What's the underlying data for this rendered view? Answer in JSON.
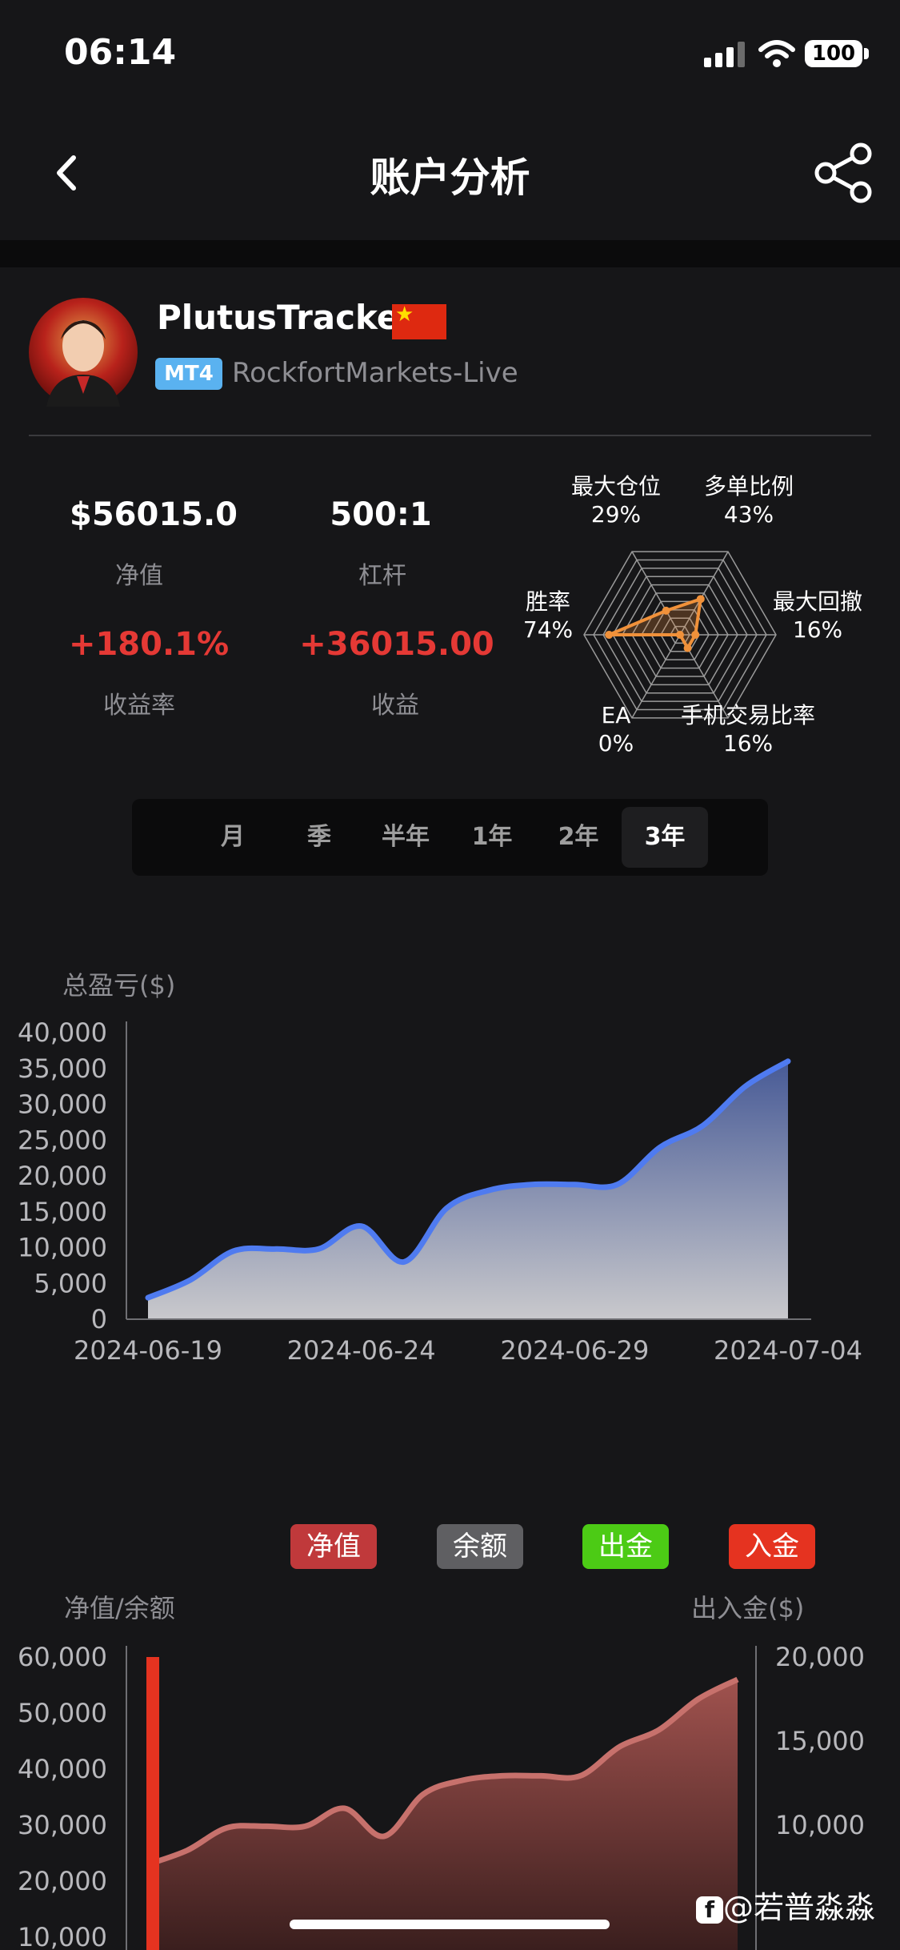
{
  "status_bar": {
    "time": "06:14",
    "battery": "100"
  },
  "header": {
    "title": "账户分析"
  },
  "profile": {
    "name": "PlutusTracker",
    "platform": "MT4",
    "server": "RockfortMarkets-Live"
  },
  "stats": {
    "equity_value": "$56015.0",
    "equity_label": "净值",
    "leverage_value": "500:1",
    "leverage_label": "杠杆",
    "return_rate_value": "+180.1%",
    "return_rate_label": "收益率",
    "profit_value": "+36015.00",
    "profit_label": "收益"
  },
  "radar": {
    "axes": [
      {
        "name": "多单比例",
        "value": "43%",
        "v": 0.43
      },
      {
        "name": "最大回撤",
        "value": "16%",
        "v": 0.16
      },
      {
        "name": "手机交易比率",
        "value": "16%",
        "v": 0.16
      },
      {
        "name": "EA",
        "value": "0%",
        "v": 0.0
      },
      {
        "name": "胜率",
        "value": "74%",
        "v": 0.74
      },
      {
        "name": "最大仓位",
        "value": "29%",
        "v": 0.29
      }
    ],
    "color": "#f0913a"
  },
  "period_tabs": {
    "items": [
      "月",
      "季",
      "半年",
      "1年",
      "2年",
      "3年"
    ],
    "active": "3年"
  },
  "pnl_chart": {
    "ylabel": "总盈亏($)"
  },
  "balance_chart": {
    "left_label": "净值/余额",
    "right_label": "出入金($)",
    "legend": [
      {
        "label": "净值",
        "color": "#c0393b"
      },
      {
        "label": "余额",
        "color": "#5f5f62"
      },
      {
        "label": "出金",
        "color": "#4ccb15"
      },
      {
        "label": "入金",
        "color": "#e53320"
      }
    ]
  },
  "watermark": "@若普淼淼",
  "chart_data": [
    {
      "type": "area",
      "title": "",
      "ylabel": "总盈亏($)",
      "xlabel": "",
      "ylim": [
        0,
        40000
      ],
      "yticks": [
        "0",
        "5,000",
        "10,000",
        "15,000",
        "20,000",
        "25,000",
        "30,000",
        "35,000",
        "40,000"
      ],
      "xticks": [
        "2024-06-19",
        "2024-06-24",
        "2024-06-29",
        "2024-07-04"
      ],
      "x": [
        "2024-06-19",
        "2024-06-20",
        "2024-06-21",
        "2024-06-22",
        "2024-06-23",
        "2024-06-24",
        "2024-06-25",
        "2024-06-26",
        "2024-06-27",
        "2024-06-28",
        "2024-06-29",
        "2024-06-30",
        "2024-07-01",
        "2024-07-02",
        "2024-07-03",
        "2024-07-04"
      ],
      "series": [
        {
          "values": [
            3000,
            5500,
            9500,
            9800,
            9800,
            13000,
            8000,
            15500,
            18000,
            18800,
            18800,
            18800,
            24000,
            27000,
            32500,
            36000
          ],
          "color": "#4f7bf0"
        }
      ],
      "grid": false
    },
    {
      "type": "area",
      "title": "",
      "ylabel": "净值/余额",
      "ylabel_right": "出入金($)",
      "ylim": [
        0,
        60000
      ],
      "ylim_right": [
        0,
        20000
      ],
      "yticks": [
        "10,000",
        "20,000",
        "30,000",
        "40,000",
        "50,000",
        "60,000"
      ],
      "yticks_right": [
        "10,000",
        "15,000",
        "20,000"
      ],
      "x": [
        "2024-06-19",
        "2024-06-20",
        "2024-06-21",
        "2024-06-22",
        "2024-06-23",
        "2024-06-24",
        "2024-06-25",
        "2024-06-26",
        "2024-06-27",
        "2024-06-28",
        "2024-06-29",
        "2024-06-30",
        "2024-07-01",
        "2024-07-02",
        "2024-07-03",
        "2024-07-04"
      ],
      "series": [
        {
          "name": "净值",
          "values": [
            23000,
            25500,
            29500,
            29800,
            29800,
            33000,
            28000,
            35500,
            38000,
            38800,
            38800,
            38800,
            44000,
            47000,
            52500,
            56000
          ],
          "color": "#c7716c"
        },
        {
          "name": "入金",
          "bar_x": "2024-06-19",
          "value": 20000,
          "color": "#e53320"
        }
      ],
      "grid": false
    }
  ]
}
